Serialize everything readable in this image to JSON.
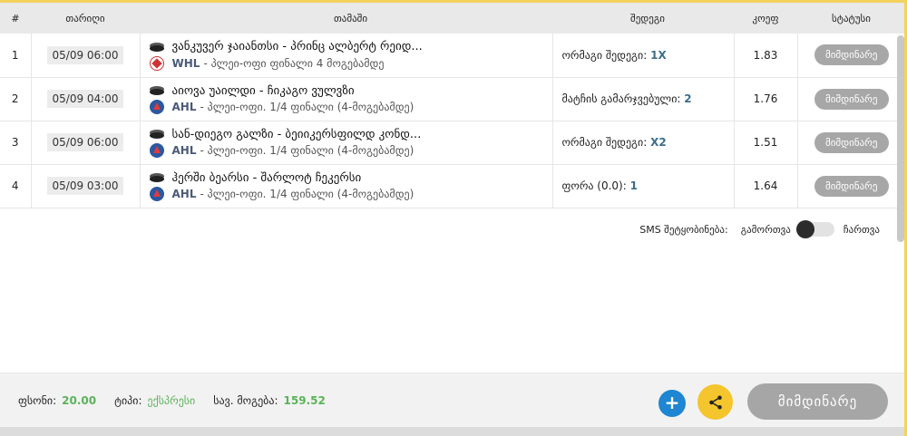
{
  "headers": {
    "num": "#",
    "date": "თარიღი",
    "match": "თამაში",
    "result": "შედეგი",
    "odd": "კოეფ",
    "status": "სტატუსი"
  },
  "rows": [
    {
      "num": "1",
      "date": "05/09 06:00",
      "teams": "ვანკუვერ ჯაიანთსი - პრინც ალბერტ რეიდ...",
      "league_abbr": "WHL",
      "league_desc": "- პლეი-ოფი ფინალი 4 მოგებამდე",
      "league_icon": "whl-logo-icon",
      "result_label": "ორმაგი შედეგი:",
      "result_value": "1X",
      "odd": "1.83",
      "status": "მიმდინარე"
    },
    {
      "num": "2",
      "date": "05/09 04:00",
      "teams": "აიოვა უაილდი - ჩიკაგო ვულვზი",
      "league_abbr": "AHL",
      "league_desc": "- პლეი-ოფი. 1/4 ფინალი (4-მოგებამდე)",
      "league_icon": "ahl-logo-icon",
      "result_label": "მატჩის გამარჯვებული:",
      "result_value": "2",
      "odd": "1.76",
      "status": "მიმდინარე"
    },
    {
      "num": "3",
      "date": "05/09 06:00",
      "teams": "სან-დიეგო გალზი - ბეიიკერსფილდ კონდ...",
      "league_abbr": "AHL",
      "league_desc": "- პლეი-ოფი. 1/4 ფინალი (4-მოგებამდე)",
      "league_icon": "ahl-logo-icon",
      "result_label": "ორმაგი შედეგი:",
      "result_value": "X2",
      "odd": "1.51",
      "status": "მიმდინარე"
    },
    {
      "num": "4",
      "date": "05/09 03:00",
      "teams": "ჰერში ბეარსი - შარლოტ ჩეკერსი",
      "league_abbr": "AHL",
      "league_desc": "- პლეი-ოფი. 1/4 ფინალი (4-მოგებამდე)",
      "league_icon": "ahl-logo-icon",
      "result_label": "ფორა (0.0):",
      "result_value": "1",
      "odd": "1.64",
      "status": "მიმდინარე"
    }
  ],
  "sms": {
    "label": "SMS შეტყობინება:",
    "off_label": "გამორთვა",
    "on_label": "ჩართვა",
    "enabled": false
  },
  "footer": {
    "bonus_label": "ფსონი:",
    "bonus_value": "20.00",
    "type_label": "ტიპი:",
    "type_value": "ექსპრესი",
    "win_label": "სავ. მოგება:",
    "win_value": "159.52",
    "plus_icon": "plus-icon",
    "share_icon": "share-icon",
    "main_button": "მიმდინარე"
  },
  "colors": {
    "accent_green": "#5bb35a",
    "plus_blue": "#1e86d2",
    "share_yellow": "#f4c52c",
    "status_gray": "#a7a7a7",
    "result_blue": "#3c6d8c"
  }
}
